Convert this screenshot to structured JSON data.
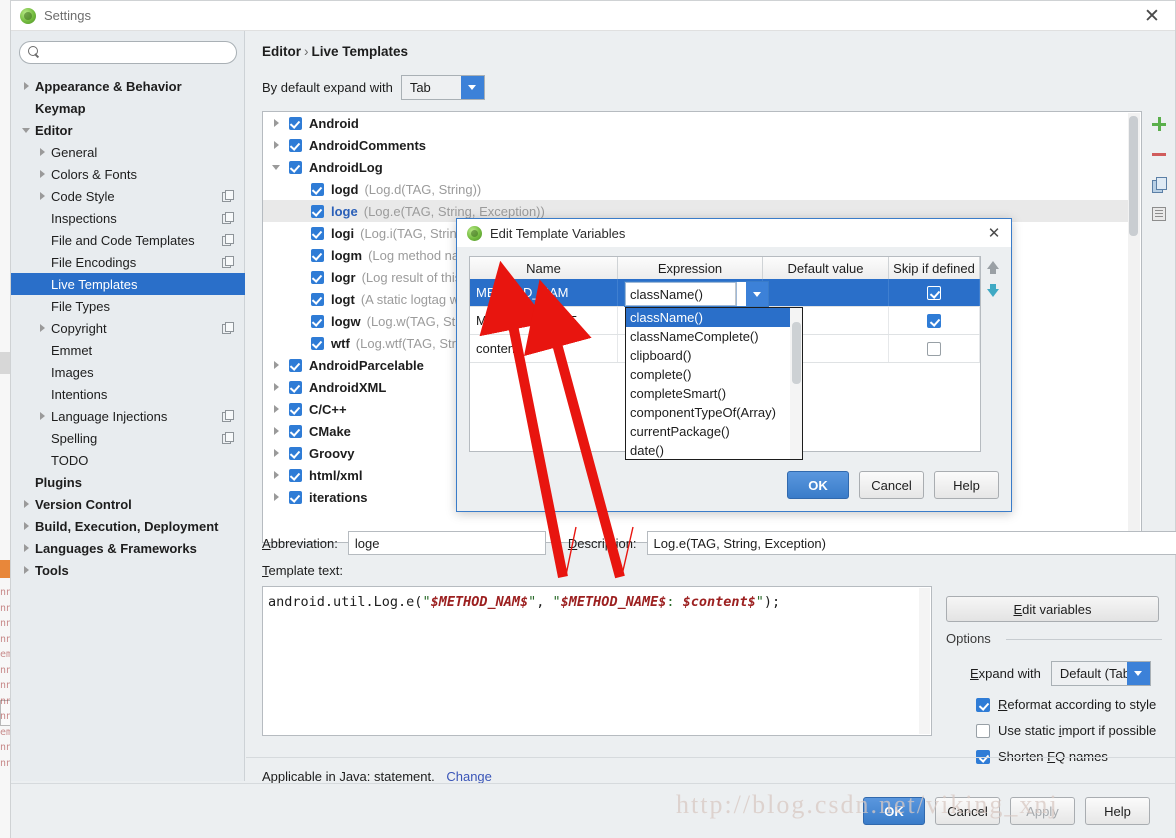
{
  "window": {
    "title": "Settings",
    "close_label": "✕",
    "icon": "android-studio-icon"
  },
  "search": {
    "value": "",
    "placeholder": "",
    "icon": "search-icon"
  },
  "sidebar": {
    "items": [
      {
        "label": "Appearance & Behavior",
        "indent": 0,
        "arrow": "right",
        "bold": true,
        "badge": false,
        "selected": false
      },
      {
        "label": "Keymap",
        "indent": 0,
        "arrow": "none",
        "bold": true,
        "badge": false,
        "selected": false
      },
      {
        "label": "Editor",
        "indent": 0,
        "arrow": "down",
        "bold": true,
        "badge": false,
        "selected": false
      },
      {
        "label": "General",
        "indent": 1,
        "arrow": "right",
        "bold": false,
        "badge": false,
        "selected": false
      },
      {
        "label": "Colors & Fonts",
        "indent": 1,
        "arrow": "right",
        "bold": false,
        "badge": false,
        "selected": false
      },
      {
        "label": "Code Style",
        "indent": 1,
        "arrow": "right",
        "bold": false,
        "badge": true,
        "selected": false
      },
      {
        "label": "Inspections",
        "indent": 1,
        "arrow": "none",
        "bold": false,
        "badge": true,
        "selected": false
      },
      {
        "label": "File and Code Templates",
        "indent": 1,
        "arrow": "none",
        "bold": false,
        "badge": true,
        "selected": false
      },
      {
        "label": "File Encodings",
        "indent": 1,
        "arrow": "none",
        "bold": false,
        "badge": true,
        "selected": false
      },
      {
        "label": "Live Templates",
        "indent": 1,
        "arrow": "none",
        "bold": false,
        "badge": false,
        "selected": true
      },
      {
        "label": "File Types",
        "indent": 1,
        "arrow": "none",
        "bold": false,
        "badge": false,
        "selected": false
      },
      {
        "label": "Copyright",
        "indent": 1,
        "arrow": "right",
        "bold": false,
        "badge": true,
        "selected": false
      },
      {
        "label": "Emmet",
        "indent": 1,
        "arrow": "none",
        "bold": false,
        "badge": false,
        "selected": false
      },
      {
        "label": "Images",
        "indent": 1,
        "arrow": "none",
        "bold": false,
        "badge": false,
        "selected": false
      },
      {
        "label": "Intentions",
        "indent": 1,
        "arrow": "none",
        "bold": false,
        "badge": false,
        "selected": false
      },
      {
        "label": "Language Injections",
        "indent": 1,
        "arrow": "right",
        "bold": false,
        "badge": true,
        "selected": false
      },
      {
        "label": "Spelling",
        "indent": 1,
        "arrow": "none",
        "bold": false,
        "badge": true,
        "selected": false
      },
      {
        "label": "TODO",
        "indent": 1,
        "arrow": "none",
        "bold": false,
        "badge": false,
        "selected": false
      },
      {
        "label": "Plugins",
        "indent": 0,
        "arrow": "none",
        "bold": true,
        "badge": false,
        "selected": false
      },
      {
        "label": "Version Control",
        "indent": 0,
        "arrow": "right",
        "bold": true,
        "badge": false,
        "selected": false
      },
      {
        "label": "Build, Execution, Deployment",
        "indent": 0,
        "arrow": "right",
        "bold": true,
        "badge": false,
        "selected": false
      },
      {
        "label": "Languages & Frameworks",
        "indent": 0,
        "arrow": "right",
        "bold": true,
        "badge": false,
        "selected": false
      },
      {
        "label": "Tools",
        "indent": 0,
        "arrow": "right",
        "bold": true,
        "badge": false,
        "selected": false
      }
    ]
  },
  "content": {
    "breadcrumb": {
      "parent": "Editor",
      "separator": "›",
      "current": "Live Templates"
    },
    "expand_with": {
      "label": "By default expand with",
      "value": "Tab"
    },
    "templates": [
      {
        "name": "Android",
        "desc": "",
        "indent": 0,
        "arrow": "right",
        "checked": true,
        "highlight": false,
        "blue": false
      },
      {
        "name": "AndroidComments",
        "desc": "",
        "indent": 0,
        "arrow": "right",
        "checked": true,
        "highlight": false,
        "blue": false
      },
      {
        "name": "AndroidLog",
        "desc": "",
        "indent": 0,
        "arrow": "down",
        "checked": true,
        "highlight": false,
        "blue": false
      },
      {
        "name": "logd",
        "desc": "(Log.d(TAG, String))",
        "indent": 1,
        "arrow": "none",
        "checked": true,
        "highlight": false,
        "blue": false
      },
      {
        "name": "loge",
        "desc": "(Log.e(TAG, String, Exception))",
        "indent": 1,
        "arrow": "none",
        "checked": true,
        "highlight": true,
        "blue": true
      },
      {
        "name": "logi",
        "desc": "(Log.i(TAG, String))",
        "indent": 1,
        "arrow": "none",
        "checked": true,
        "highlight": false,
        "blue": false
      },
      {
        "name": "logm",
        "desc": "(Log method name and its arguments)",
        "indent": 1,
        "arrow": "none",
        "checked": true,
        "highlight": false,
        "blue": false
      },
      {
        "name": "logr",
        "desc": "(Log result of this method)",
        "indent": 1,
        "arrow": "none",
        "checked": true,
        "highlight": false,
        "blue": false
      },
      {
        "name": "logt",
        "desc": "(A static logtag with the class name)",
        "indent": 1,
        "arrow": "none",
        "checked": true,
        "highlight": false,
        "blue": false
      },
      {
        "name": "logw",
        "desc": "(Log.w(TAG, String))",
        "indent": 1,
        "arrow": "none",
        "checked": true,
        "highlight": false,
        "blue": false
      },
      {
        "name": "wtf",
        "desc": "(Log.wtf(TAG, String))",
        "indent": 1,
        "arrow": "none",
        "checked": true,
        "highlight": false,
        "blue": false
      },
      {
        "name": "AndroidParcelable",
        "desc": "",
        "indent": 0,
        "arrow": "right",
        "checked": true,
        "highlight": false,
        "blue": false
      },
      {
        "name": "AndroidXML",
        "desc": "",
        "indent": 0,
        "arrow": "right",
        "checked": true,
        "highlight": false,
        "blue": false
      },
      {
        "name": "C/C++",
        "desc": "",
        "indent": 0,
        "arrow": "right",
        "checked": true,
        "highlight": false,
        "blue": false
      },
      {
        "name": "CMake",
        "desc": "",
        "indent": 0,
        "arrow": "right",
        "checked": true,
        "highlight": false,
        "blue": false
      },
      {
        "name": "Groovy",
        "desc": "",
        "indent": 0,
        "arrow": "right",
        "checked": true,
        "highlight": false,
        "blue": false
      },
      {
        "name": "html/xml",
        "desc": "",
        "indent": 0,
        "arrow": "right",
        "checked": true,
        "highlight": false,
        "blue": false
      },
      {
        "name": "iterations",
        "desc": "",
        "indent": 0,
        "arrow": "right",
        "checked": true,
        "highlight": false,
        "blue": false
      }
    ],
    "side_tools": [
      {
        "icon": "plus-icon",
        "name": "add-template-button"
      },
      {
        "icon": "minus-icon",
        "name": "remove-template-button"
      },
      {
        "icon": "copy-icon",
        "name": "duplicate-template-button"
      },
      {
        "icon": "document-icon",
        "name": "template-group-button"
      }
    ],
    "abbreviation": {
      "label": "Abbreviation:",
      "value": "loge"
    },
    "description": {
      "label": "Description:",
      "value": "Log.e(TAG, String, Exception)"
    },
    "template_text": {
      "label": "Template text:",
      "segments": [
        {
          "t": "android.util.Log.e(",
          "k": "punc"
        },
        {
          "t": "\"",
          "k": "str"
        },
        {
          "t": "$METHOD_NAM$",
          "k": "var"
        },
        {
          "t": "\"",
          "k": "str"
        },
        {
          "t": ", ",
          "k": "punc"
        },
        {
          "t": "\"",
          "k": "str"
        },
        {
          "t": "$METHOD_NAME$",
          "k": "var"
        },
        {
          "t": ": ",
          "k": "str"
        },
        {
          "t": "$content$",
          "k": "var"
        },
        {
          "t": "\"",
          "k": "str"
        },
        {
          "t": ");",
          "k": "punc"
        }
      ]
    },
    "edit_variables_label": "Edit variables",
    "options": {
      "title": "Options",
      "expand_with": {
        "label": "Expand with",
        "value": "Default (Tab)"
      },
      "checkboxes": [
        {
          "label": "Reformat according to style",
          "checked": true
        },
        {
          "label": "Use static import if possible",
          "checked": false
        },
        {
          "label": "Shorten FQ names",
          "checked": true
        }
      ]
    },
    "applicable": {
      "text": "Applicable in Java: statement.",
      "link": "Change"
    }
  },
  "bottom_buttons": [
    {
      "label": "OK",
      "style": "primary"
    },
    {
      "label": "Cancel",
      "style": "normal"
    },
    {
      "label": "Apply",
      "style": "disabled"
    },
    {
      "label": "Help",
      "style": "normal"
    }
  ],
  "dialog": {
    "title": "Edit Template Variables",
    "close_label": "✕",
    "columns": [
      "Name",
      "Expression",
      "Default value",
      "Skip if defined"
    ],
    "rows": [
      {
        "name": "METHOD_NAM",
        "expression": "className()",
        "default": "",
        "skip": true,
        "selected": true,
        "editing": true
      },
      {
        "name": "METHOD_NAME",
        "expression": "",
        "default": "",
        "skip": true,
        "selected": false,
        "editing": false
      },
      {
        "name": "content",
        "expression": "",
        "default": "",
        "skip": false,
        "selected": false,
        "editing": false
      }
    ],
    "editor_value": "className()",
    "dropdown_options": [
      "className()",
      "classNameComplete()",
      "clipboard()",
      "complete()",
      "completeSmart()",
      "componentTypeOf(Array)",
      "currentPackage()",
      "date()"
    ],
    "dropdown_selected_index": 0,
    "move_up_icon": "arrow-up-icon",
    "move_down_icon": "arrow-down-icon",
    "buttons": [
      {
        "label": "OK",
        "style": "primary"
      },
      {
        "label": "Cancel",
        "style": "normal"
      },
      {
        "label": "Help",
        "style": "normal"
      }
    ]
  },
  "watermark": {
    "text": "http://blog.csdn.net/viking_xnj"
  }
}
